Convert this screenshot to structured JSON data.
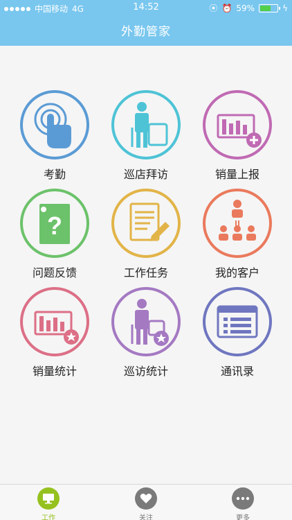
{
  "status_bar": {
    "carrier": "中国移动",
    "network": "4G",
    "time": "14:52",
    "battery": "59%",
    "battery_level": 0.59
  },
  "header": {
    "title": "外勤管家"
  },
  "tiles": [
    {
      "label": "考勤",
      "icon": "touch-icon",
      "color": "#5b9bd5"
    },
    {
      "label": "巡店拜访",
      "icon": "visit-icon",
      "color": "#4ec3d6"
    },
    {
      "label": "销量上报",
      "icon": "sales-report-icon",
      "color": "#c06ab3"
    },
    {
      "label": "问题反馈",
      "icon": "question-icon",
      "color": "#6cc26a"
    },
    {
      "label": "工作任务",
      "icon": "task-icon",
      "color": "#e2b448"
    },
    {
      "label": "我的客户",
      "icon": "customers-icon",
      "color": "#ea7a5d"
    },
    {
      "label": "销量统计",
      "icon": "sales-stats-icon",
      "color": "#dc6f86"
    },
    {
      "label": "巡访统计",
      "icon": "visit-stats-icon",
      "color": "#a479c2"
    },
    {
      "label": "通讯录",
      "icon": "contacts-icon",
      "color": "#6f76c0"
    }
  ],
  "tabbar": [
    {
      "label": "工作",
      "icon": "monitor-icon",
      "active": true,
      "color": "#95c11f"
    },
    {
      "label": "关注",
      "icon": "heart-icon",
      "active": false,
      "color": "#7a7a7a"
    },
    {
      "label": "更多",
      "icon": "more-icon",
      "active": false,
      "color": "#7a7a7a"
    }
  ]
}
